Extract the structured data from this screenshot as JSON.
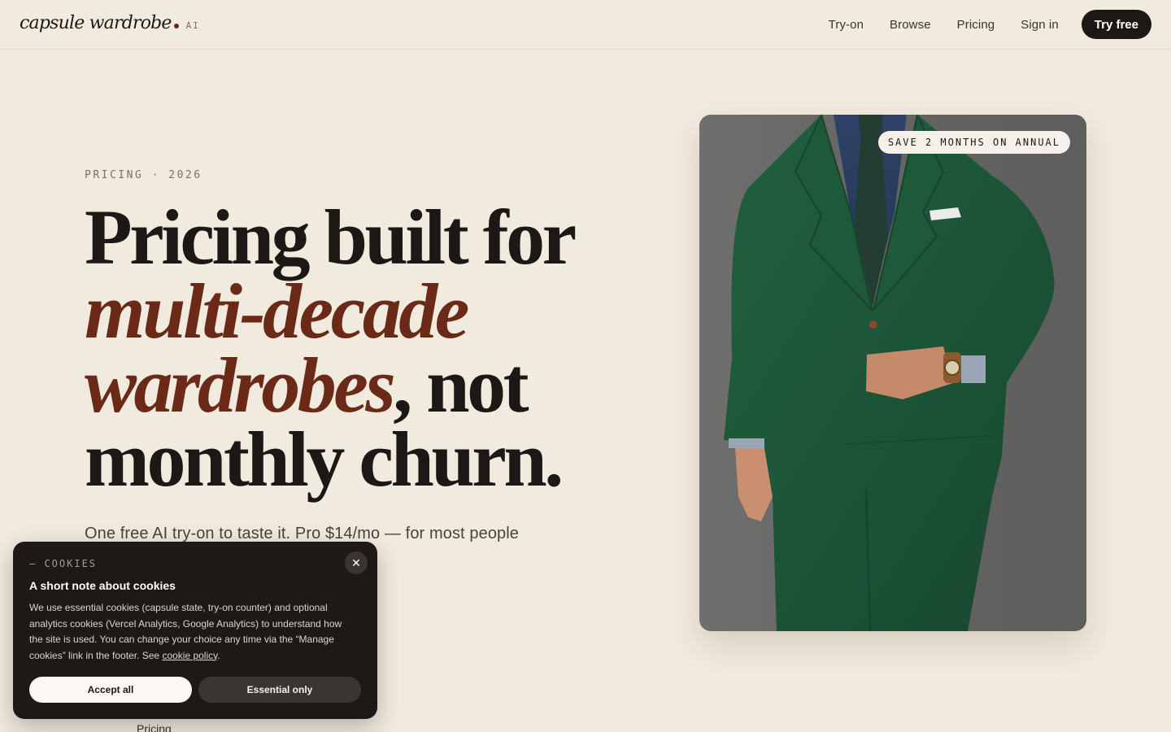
{
  "header": {
    "logo_text": "capsule wardrobe",
    "logo_suffix": "AI",
    "nav": [
      {
        "label": "Try-on"
      },
      {
        "label": "Browse"
      },
      {
        "label": "Pricing"
      },
      {
        "label": "Sign in"
      }
    ],
    "cta_label": "Try free"
  },
  "hero": {
    "eyebrow": "PRICING · 2026",
    "headline_line1": "Pricing built for",
    "headline_accent1": "multi-decade",
    "headline_accent2": "wardrobes",
    "headline_tail2": ", not",
    "headline_line4": "monthly churn.",
    "subtitle": "One free AI try-on to taste it. Pro $14/mo — for most people"
  },
  "photo": {
    "badge": "SAVE 2 MONTHS ON ANNUAL"
  },
  "partially_hidden": {
    "link": "Pricing"
  },
  "cookie": {
    "eyebrow": "— COOKIES",
    "title": "A short note about cookies",
    "body": "We use essential cookies (capsule state, try-on counter) and optional analytics cookies (Vercel Analytics, Google Analytics) to understand how the site is used. You can change your choice any time via the “Manage cookies” link in the footer. See ",
    "policy_link": "cookie policy",
    "body_end": ".",
    "accept_label": "Accept all",
    "essential_label": "Essential only",
    "close_glyph": "✕"
  },
  "colors": {
    "background": "#f1eade",
    "accent": "#6b2a17",
    "ink": "#1c1815",
    "suit_green": "#1f5a3c"
  }
}
